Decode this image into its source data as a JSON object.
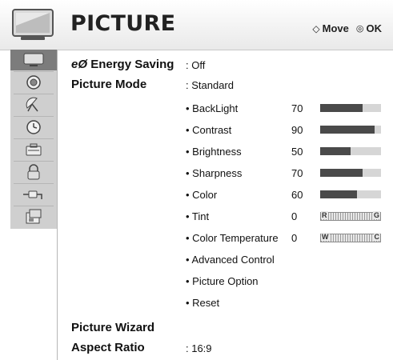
{
  "header": {
    "title": "PICTURE",
    "move_label": "Move",
    "ok_label": "OK"
  },
  "sidebar": {
    "icons": [
      "picture-icon",
      "audio-icon",
      "channel-icon",
      "clock-icon",
      "lock-option-icon",
      "lock-icon",
      "input-icon",
      "usb-icon"
    ],
    "selected_index": 0
  },
  "menu": {
    "energy_saving": {
      "icon_text": "eØ",
      "label": "Energy Saving",
      "value": ": Off"
    },
    "picture_mode": {
      "label": "Picture Mode",
      "value": ": Standard"
    },
    "settings": [
      {
        "label": "• BackLight",
        "value": "70",
        "level": 70
      },
      {
        "label": "• Contrast",
        "value": "90",
        "level": 90
      },
      {
        "label": "• Brightness",
        "value": "50",
        "level": 50
      },
      {
        "label": "• Sharpness",
        "value": "70",
        "level": 70
      },
      {
        "label": "• Color",
        "value": "60",
        "level": 60
      }
    ],
    "tint": {
      "label": "• Tint",
      "value": "0",
      "left": "R",
      "right": "G"
    },
    "color_temp": {
      "label": "• Color Temperature",
      "value": "0",
      "left": "W",
      "right": "C"
    },
    "links": [
      "• Advanced Control",
      "• Picture Option",
      "• Reset"
    ],
    "picture_wizard": {
      "label": "Picture Wizard"
    },
    "aspect_ratio": {
      "label": "Aspect Ratio",
      "value": ": 16:9"
    }
  },
  "colors": {
    "bar_fill": "#4a4a4a",
    "bar_track": "#d6d6d6",
    "sidebar": "#cfcfcf",
    "sidebar_selected": "#7c7c7c"
  }
}
